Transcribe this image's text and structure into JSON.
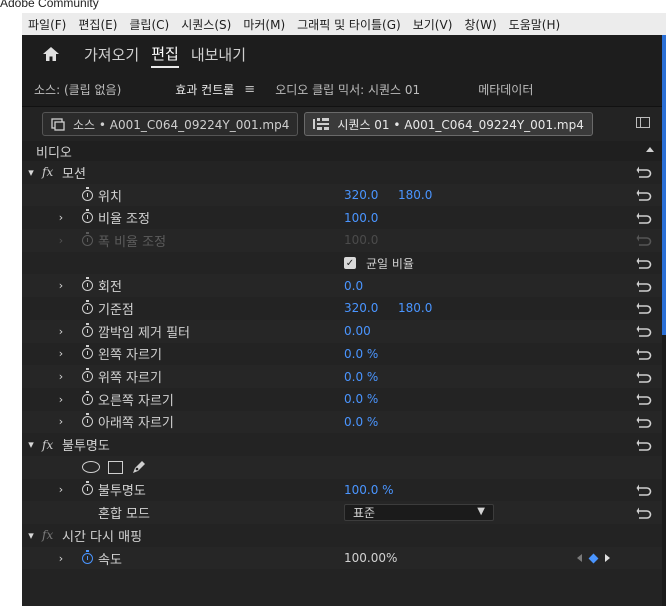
{
  "site": {
    "label": "Adobe Community"
  },
  "menu": [
    "파일(F)",
    "편집(E)",
    "클립(C)",
    "시퀀스(S)",
    "마커(M)",
    "그래픽 및 타이틀(G)",
    "보기(V)",
    "창(W)",
    "도움말(H)"
  ],
  "workspace": {
    "tabs": [
      "가져오기",
      "편집",
      "내보내기"
    ],
    "active": "편집"
  },
  "panels": {
    "source": "소스: (클립 없음)",
    "effect_controls": "효과 컨트롤",
    "audio_mixer": "오디오 클립 믹서: 시퀀스 01",
    "metadata": "메타데이터"
  },
  "clips": {
    "source_clip": "소스 • A001_C064_09224Y_001.mp4",
    "sequence_clip": "시퀀스 01 • A001_C064_09224Y_001.mp4"
  },
  "section": {
    "video": "비디오"
  },
  "effects": {
    "motion": {
      "title": "모션",
      "position": {
        "label": "위치",
        "x": "320.0",
        "y": "180.0"
      },
      "scale": {
        "label": "비율 조정",
        "value": "100.0"
      },
      "scale_width": {
        "label": "폭 비율 조정",
        "value": "100.0"
      },
      "uniform_scale": {
        "label": "균일 비율",
        "checked": true
      },
      "rotation": {
        "label": "회전",
        "value": "0.0"
      },
      "anchor": {
        "label": "기준점",
        "x": "320.0",
        "y": "180.0"
      },
      "flicker": {
        "label": "깜박임 제거 필터",
        "value": "0.00"
      },
      "crop_left": {
        "label": "왼쪽 자르기",
        "value": "0.0 %"
      },
      "crop_top": {
        "label": "위쪽 자르기",
        "value": "0.0 %"
      },
      "crop_right": {
        "label": "오른쪽 자르기",
        "value": "0.0 %"
      },
      "crop_bottom": {
        "label": "아래쪽 자르기",
        "value": "0.0 %"
      }
    },
    "opacity": {
      "title": "불투명도",
      "value_label": "불투명도",
      "value": "100.0 %",
      "blend_label": "혼합 모드",
      "blend_value": "표준"
    },
    "time_remap": {
      "title": "시간 다시 매핑",
      "speed_label": "속도",
      "speed_value": "100.00%"
    }
  },
  "colors": {
    "accent": "#4a95ff",
    "panel_bg": "#232323"
  }
}
